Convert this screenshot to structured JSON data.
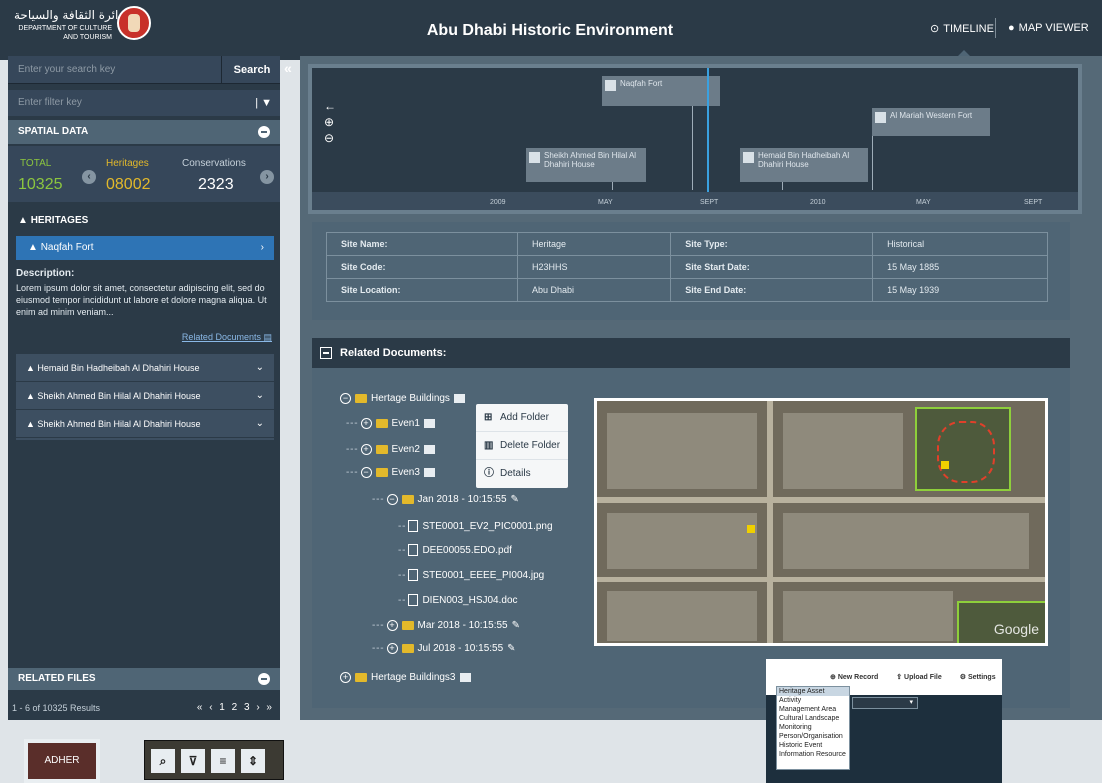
{
  "header": {
    "logo_ar": "دائرة الثقافة والسياحة",
    "logo_en_line1": "DEPARTMENT OF CULTURE",
    "logo_en_line2": "AND TOURISM",
    "title": "Abu Dhabi Historic Environment",
    "nav_timeline": "TIMELINE",
    "nav_map_viewer": "MAP VIEWER"
  },
  "sidebar": {
    "search_placeholder": "Enter your search key",
    "search_button": "Search",
    "filter_placeholder": "Enter filter key",
    "spatial_data": "SPATIAL DATA",
    "total_label": "TOTAL",
    "total_value": "10325",
    "heritages_label": "Heritages",
    "heritages_value": "08002",
    "conservations_label": "Conservations",
    "conservations_value": "2323",
    "heritages_section": "HERITAGES",
    "selected_item": "Naqfah Fort",
    "description_label": "Description:",
    "description_text": "Lorem ipsum dolor sit amet, consectetur adipiscing elit, sed do eiusmod tempor incididunt ut labore et dolore magna aliqua. Ut enim ad minim veniam...",
    "related_documents_link": "Related Documents",
    "items": [
      {
        "label": "Hemaid Bin Hadheibah Al Dhahiri House"
      },
      {
        "label": "Sheikh Ahmed Bin Hilal Al Dhahiri House"
      },
      {
        "label": "Sheikh Ahmed Bin Hilal Al Dhahiri House"
      }
    ],
    "related_files": "RELATED FILES",
    "results_text": "1 - 6 of 10325 Results",
    "pager": "« ‹ 1 2 3 › »"
  },
  "timeline": {
    "events": [
      {
        "label": "Naqfah Fort"
      },
      {
        "label": "Sheikh Ahmed Bin Hilal Al Dhahiri House"
      },
      {
        "label": "Hemaid Bin Hadheibah Al Dhahiri House"
      },
      {
        "label": "Al Mariah Western Fort"
      }
    ],
    "ticks": [
      "2009",
      "MAY",
      "SEPT",
      "2010",
      "MAY",
      "SEPT"
    ]
  },
  "site_info": {
    "name_label": "Site Name:",
    "name_value": "Heritage",
    "type_label": "Site Type:",
    "type_value": "Historical",
    "code_label": "Site Code:",
    "code_value": "H23HHS",
    "start_label": "Site Start Date:",
    "start_value": "15 May 1885",
    "location_label": "Site Location:",
    "location_value": "Abu Dhabi",
    "end_label": "Site End Date:",
    "end_value": "15 May 1939"
  },
  "documents": {
    "title": "Related Documents:",
    "root": "Hertage Buildings",
    "even1": "Even1",
    "even2": "Even2",
    "even3": "Even3",
    "jan": "Jan 2018 - 10:15:55",
    "files": [
      "STE0001_EV2_PIC0001.png",
      "DEE00055.EDO.pdf",
      "STE0001_EEEE_PI004.jpg",
      "DIEN003_HSJ04.doc"
    ],
    "mar": "Mar 2018 - 10:15:55",
    "jul": "Jul 2018 - 10:15:55",
    "root3": "Hertage Buildings3",
    "context_menu": {
      "add": "Add Folder",
      "delete": "Delete Folder",
      "details": "Details"
    }
  },
  "map": {
    "attribution": "Google"
  },
  "record_snip": {
    "new_record": "New Record",
    "upload_file": "Upload File",
    "settings": "Settings",
    "options": [
      "Heritage Asset",
      "Activity",
      "Management Area",
      "Cultural Landscape",
      "Monitoring",
      "Person/Organisation",
      "Historic Event",
      "Information Resource"
    ]
  },
  "bottom": {
    "adher": "ADHER"
  }
}
